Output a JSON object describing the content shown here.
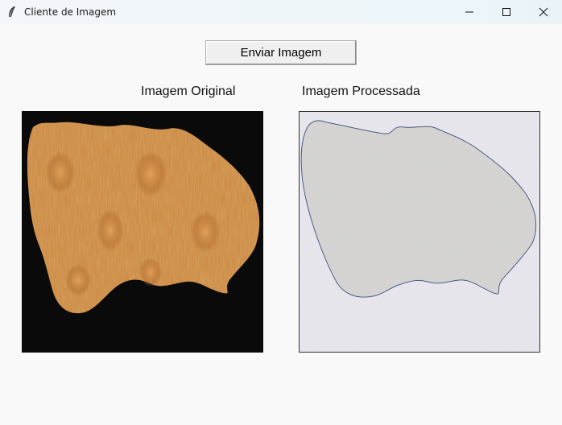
{
  "window": {
    "title": "Cliente de Imagem",
    "app_icon": "feather-icon",
    "controls": [
      "minimize-icon",
      "maximize-icon",
      "close-icon"
    ]
  },
  "toolbar": {
    "send_label": "Enviar Imagem"
  },
  "panels": {
    "original_label": "Imagem Original",
    "processed_label": "Imagem Processada"
  },
  "colors": {
    "window_bg": "#f9f9f9",
    "original_bg": "#0a0a0a",
    "original_fill": "#c8843c",
    "processed_bg": "#dcdce2",
    "processed_fill": "#c6c6c0",
    "processed_outline": "#2a3e66"
  }
}
